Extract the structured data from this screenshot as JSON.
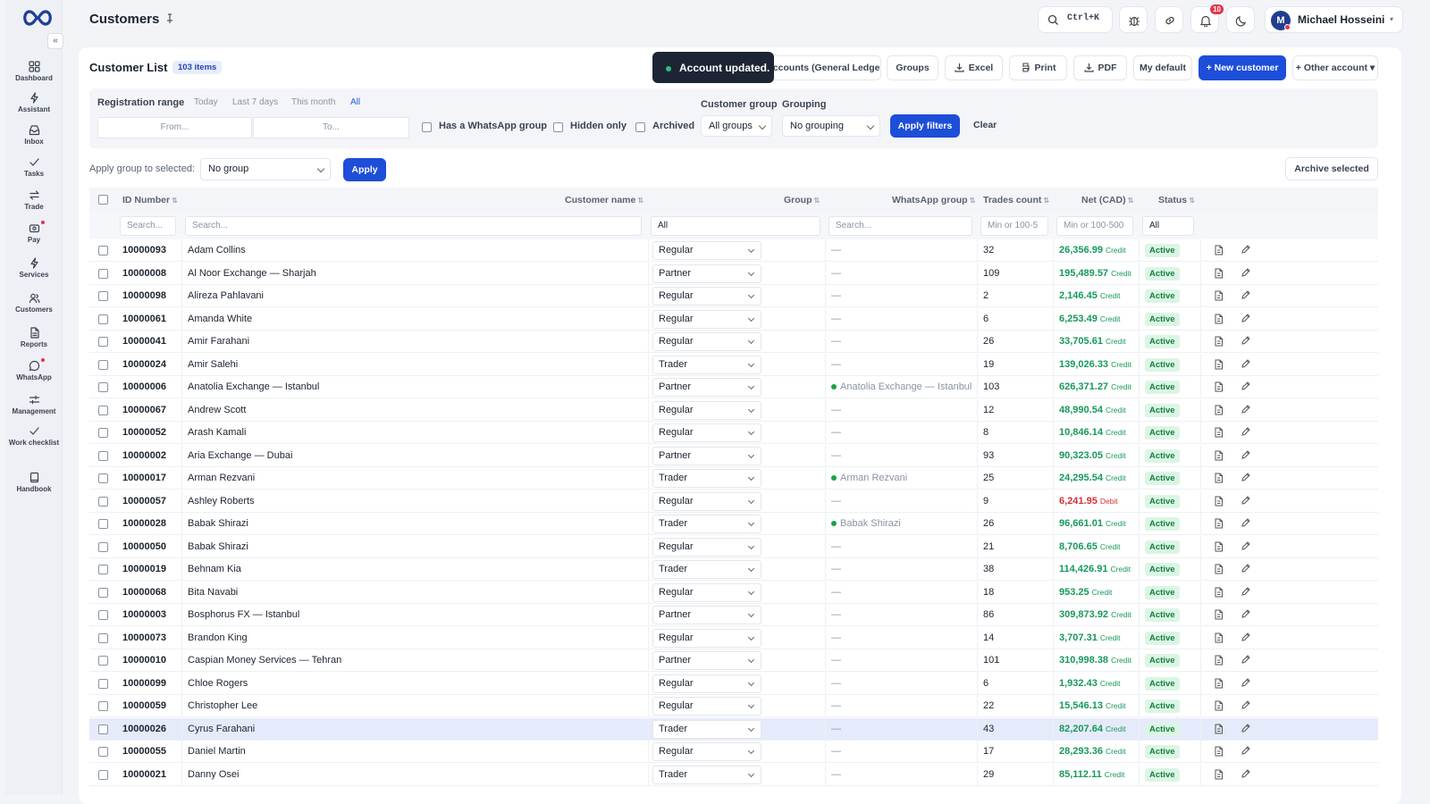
{
  "app": {
    "title": "Customers"
  },
  "nav": [
    {
      "label": "Dashboard",
      "icon": "dashboard-icon"
    },
    {
      "label": "Assistant",
      "icon": "bolt-icon"
    },
    {
      "label": "Inbox",
      "icon": "inbox-icon"
    },
    {
      "label": "Tasks",
      "icon": "check-icon"
    },
    {
      "label": "Trade",
      "icon": "swap-icon"
    },
    {
      "label": "Pay",
      "icon": "wallet-icon"
    },
    {
      "label": "Services",
      "icon": "bolt-icon"
    },
    {
      "label": "Customers",
      "icon": "users-icon"
    },
    {
      "label": "Reports",
      "icon": "report-icon"
    },
    {
      "label": "WhatsApp",
      "icon": "chat-icon"
    },
    {
      "label": "Management",
      "icon": "sliders-icon"
    },
    {
      "label": "Work checklist",
      "icon": "check-icon"
    },
    {
      "label": "Handbook",
      "icon": "book-icon"
    }
  ],
  "topbar": {
    "shortcut": "Ctrl+K",
    "notifications": "10",
    "user_initial": "M",
    "user_name": "Michael Hosseini"
  },
  "card": {
    "title": "Customer List",
    "count": "103 items"
  },
  "toast": {
    "text": "Account updated."
  },
  "actions": {
    "ledger": "r accounts (General Ledger)",
    "groups": "Groups",
    "excel": "Excel",
    "print": "Print",
    "pdf": "PDF",
    "my_default": "My default",
    "new_customer": "+ New customer",
    "other_account": "+ Other account ▾"
  },
  "filters": {
    "registration_range": "Registration range",
    "range_options": [
      "Today",
      "Last 7 days",
      "This month",
      "All"
    ],
    "from_placeholder": "From...",
    "to_placeholder": "To...",
    "has_whatsapp": "Has a WhatsApp group",
    "hidden_only": "Hidden only",
    "archived": "Archived",
    "customer_group_label": "Customer group",
    "customer_group_value": "All groups",
    "grouping_label": "Grouping",
    "grouping_value": "No grouping",
    "apply_filters": "Apply filters",
    "clear": "Clear"
  },
  "bulk": {
    "label": "Apply group to selected:",
    "value": "No group",
    "apply": "Apply",
    "archive": "Archive selected"
  },
  "columns": {
    "id": "ID Number",
    "name": "Customer name",
    "group": "Group",
    "whatsapp": "WhatsApp group",
    "trades": "Trades count",
    "net": "Net (CAD)",
    "status": "Status"
  },
  "column_filters": {
    "id": "Search...",
    "name": "Search...",
    "group": "All",
    "whatsapp": "Search...",
    "trades": "Min or 100-5",
    "net": "Min or 100-500",
    "status": "All"
  },
  "rows": [
    {
      "id": "10000093",
      "name": "Adam Collins",
      "group": "Regular",
      "wa": "—",
      "trades": "32",
      "net": "26,356.99",
      "kind": "Credit",
      "status": "Active"
    },
    {
      "id": "10000008",
      "name": "Al Noor Exchange — Sharjah",
      "group": "Partner",
      "wa": "—",
      "trades": "109",
      "net": "195,489.57",
      "kind": "Credit",
      "status": "Active"
    },
    {
      "id": "10000098",
      "name": "Alireza Pahlavani",
      "group": "Regular",
      "wa": "—",
      "trades": "2",
      "net": "2,146.45",
      "kind": "Credit",
      "status": "Active"
    },
    {
      "id": "10000061",
      "name": "Amanda White",
      "group": "Regular",
      "wa": "—",
      "trades": "6",
      "net": "6,253.49",
      "kind": "Credit",
      "status": "Active"
    },
    {
      "id": "10000041",
      "name": "Amir Farahani",
      "group": "Regular",
      "wa": "—",
      "trades": "26",
      "net": "33,705.61",
      "kind": "Credit",
      "status": "Active"
    },
    {
      "id": "10000024",
      "name": "Amir Salehi",
      "group": "Trader",
      "wa": "—",
      "trades": "19",
      "net": "139,026.33",
      "kind": "Credit",
      "status": "Active"
    },
    {
      "id": "10000006",
      "name": "Anatolia Exchange — Istanbul",
      "group": "Partner",
      "wa": "Anatolia Exchange — Istanbul",
      "trades": "103",
      "net": "626,371.27",
      "kind": "Credit",
      "status": "Active"
    },
    {
      "id": "10000067",
      "name": "Andrew Scott",
      "group": "Regular",
      "wa": "—",
      "trades": "12",
      "net": "48,990.54",
      "kind": "Credit",
      "status": "Active"
    },
    {
      "id": "10000052",
      "name": "Arash Kamali",
      "group": "Regular",
      "wa": "—",
      "trades": "8",
      "net": "10,846.14",
      "kind": "Credit",
      "status": "Active"
    },
    {
      "id": "10000002",
      "name": "Aria Exchange — Dubai",
      "group": "Partner",
      "wa": "—",
      "trades": "93",
      "net": "90,323.05",
      "kind": "Credit",
      "status": "Active"
    },
    {
      "id": "10000017",
      "name": "Arman Rezvani",
      "group": "Trader",
      "wa": "Arman Rezvani",
      "trades": "25",
      "net": "24,295.54",
      "kind": "Credit",
      "status": "Active"
    },
    {
      "id": "10000057",
      "name": "Ashley Roberts",
      "group": "Regular",
      "wa": "—",
      "trades": "9",
      "net": "6,241.95",
      "kind": "Debit",
      "status": "Active"
    },
    {
      "id": "10000028",
      "name": "Babak Shirazi",
      "group": "Trader",
      "wa": "Babak Shirazi",
      "trades": "26",
      "net": "96,661.01",
      "kind": "Credit",
      "status": "Active"
    },
    {
      "id": "10000050",
      "name": "Babak Shirazi",
      "group": "Regular",
      "wa": "—",
      "trades": "21",
      "net": "8,706.65",
      "kind": "Credit",
      "status": "Active"
    },
    {
      "id": "10000019",
      "name": "Behnam Kia",
      "group": "Trader",
      "wa": "—",
      "trades": "38",
      "net": "114,426.91",
      "kind": "Credit",
      "status": "Active"
    },
    {
      "id": "10000068",
      "name": "Bita Navabi",
      "group": "Regular",
      "wa": "—",
      "trades": "18",
      "net": "953.25",
      "kind": "Credit",
      "status": "Active"
    },
    {
      "id": "10000003",
      "name": "Bosphorus FX — Istanbul",
      "group": "Partner",
      "wa": "—",
      "trades": "86",
      "net": "309,873.92",
      "kind": "Credit",
      "status": "Active"
    },
    {
      "id": "10000073",
      "name": "Brandon King",
      "group": "Regular",
      "wa": "—",
      "trades": "14",
      "net": "3,707.31",
      "kind": "Credit",
      "status": "Active"
    },
    {
      "id": "10000010",
      "name": "Caspian Money Services — Tehran",
      "group": "Partner",
      "wa": "—",
      "trades": "101",
      "net": "310,998.38",
      "kind": "Credit",
      "status": "Active"
    },
    {
      "id": "10000099",
      "name": "Chloe Rogers",
      "group": "Regular",
      "wa": "—",
      "trades": "6",
      "net": "1,932.43",
      "kind": "Credit",
      "status": "Active"
    },
    {
      "id": "10000059",
      "name": "Christopher Lee",
      "group": "Regular",
      "wa": "—",
      "trades": "22",
      "net": "15,546.13",
      "kind": "Credit",
      "status": "Active"
    },
    {
      "id": "10000026",
      "name": "Cyrus Farahani",
      "group": "Trader",
      "wa": "—",
      "trades": "43",
      "net": "82,207.64",
      "kind": "Credit",
      "status": "Active",
      "highlighted": true
    },
    {
      "id": "10000055",
      "name": "Daniel Martin",
      "group": "Regular",
      "wa": "—",
      "trades": "17",
      "net": "28,293.36",
      "kind": "Credit",
      "status": "Active"
    },
    {
      "id": "10000021",
      "name": "Danny Osei",
      "group": "Trader",
      "wa": "—",
      "trades": "29",
      "net": "85,112.11",
      "kind": "Credit",
      "status": "Active"
    }
  ],
  "colors": {
    "accent": "#1d4ed8",
    "credit": "#17995a",
    "debit": "#d32f3a",
    "status_bg": "#dcf5e5",
    "highlight": "#e6ebfb"
  }
}
